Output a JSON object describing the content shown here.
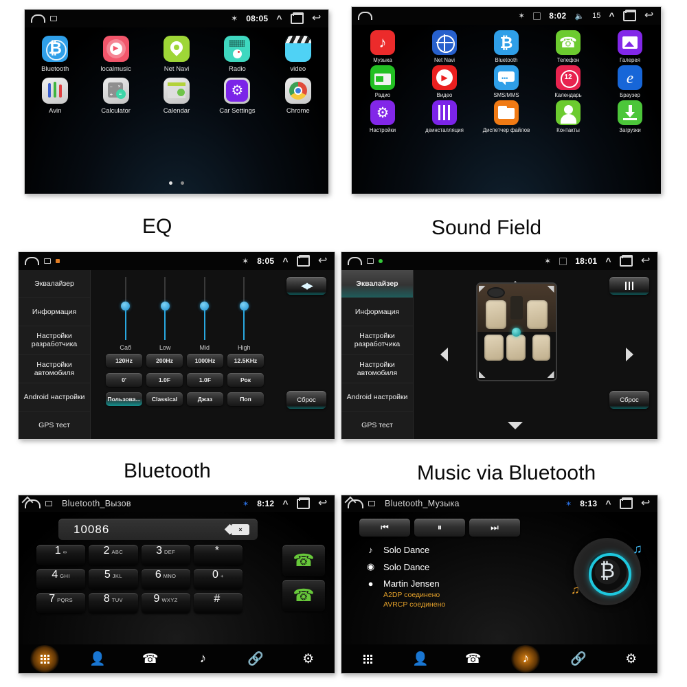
{
  "captions": {
    "eq": "EQ",
    "sound_field": "Sound Field",
    "bluetooth": "Bluetooth",
    "music_via_bluetooth": "Music via Bluetooth"
  },
  "panel1": {
    "status": {
      "time": "08:05",
      "bluetooth_icon": "bluetooth-icon",
      "chevron_icon": "chevron-up-icon",
      "recents_icon": "recents-icon",
      "back_icon": "back-icon",
      "home_icon": "home-icon"
    },
    "apps": [
      {
        "label": "Bluetooth",
        "icon": "bluetooth-icon",
        "bg": "#2f9fe8",
        "glyph": "฿"
      },
      {
        "label": "localmusic",
        "icon": "music-player-icon",
        "bg": "#f2566b",
        "glyph": "▶"
      },
      {
        "label": "Net Navi",
        "icon": "map-pin-icon",
        "bg": "#9ed637",
        "glyph": "⬤"
      },
      {
        "label": "Radio",
        "icon": "radio-icon",
        "bg": "#3fd8c0",
        "glyph": "◉"
      },
      {
        "label": "video",
        "icon": "clapperboard-icon",
        "bg": "#4fd2f5",
        "glyph": ""
      },
      {
        "label": "Avin",
        "icon": "avin-sliders-icon",
        "bg": "#d8d8d8",
        "glyph": "‖"
      },
      {
        "label": "Calculator",
        "icon": "calculator-icon",
        "bg": "#cfcfcf",
        "glyph": "="
      },
      {
        "label": "Calendar",
        "icon": "calendar-icon",
        "bg": "#cfcfcf",
        "glyph": ""
      },
      {
        "label": "Car Settings",
        "icon": "gear-icon",
        "bg": "#7b24e8",
        "glyph": "⚙"
      },
      {
        "label": "Chrome",
        "icon": "chrome-icon",
        "bg": "#e6e6e6",
        "glyph": "●"
      }
    ],
    "pager": {
      "active_index": 0,
      "count": 2
    }
  },
  "panel2": {
    "status": {
      "time": "8:02",
      "volume": "15",
      "bluetooth_icon": "bluetooth-icon",
      "signal_off_icon": "signal-off-icon",
      "volume_icon": "volume-icon",
      "chevron_icon": "chevron-up-icon",
      "recents_icon": "recents-icon",
      "back_icon": "back-icon",
      "home_icon": "home-icon"
    },
    "apps": [
      {
        "label": "Музыка",
        "icon": "music-note-icon",
        "bg": "#ec2b2b",
        "glyph": "♪"
      },
      {
        "label": "Net Navi",
        "icon": "compass-icon",
        "bg": "#2760cc",
        "glyph": "✲"
      },
      {
        "label": "Bluetooth",
        "icon": "bluetooth-icon",
        "bg": "#2f9fe8",
        "glyph": "฿"
      },
      {
        "label": "Телефон",
        "icon": "phone-icon",
        "bg": "#6ccb2f",
        "glyph": "✆"
      },
      {
        "label": "Галерея",
        "icon": "gallery-icon",
        "bg": "#8227e8",
        "glyph": "ὛB"
      },
      {
        "label": "Радио",
        "icon": "radio-icon",
        "bg": "#23c023",
        "glyph": "▤"
      },
      {
        "label": "Видео",
        "icon": "video-play-icon",
        "bg": "#ea1f1f",
        "glyph": "▶"
      },
      {
        "label": "SMS/MMS",
        "icon": "message-icon",
        "bg": "#2f9fe8",
        "glyph": "…"
      },
      {
        "label": "Календарь",
        "icon": "calendar-icon",
        "bg": "#e8234f",
        "glyph": "12"
      },
      {
        "label": "Браузер",
        "icon": "explorer-icon",
        "bg": "#1766d8",
        "glyph": "e"
      },
      {
        "label": "Настройки",
        "icon": "gear-icon",
        "bg": "#8227e8",
        "glyph": "⚙"
      },
      {
        "label": "деинсталляция",
        "icon": "uninstall-icon",
        "bg": "#7b24e8",
        "glyph": "‖"
      },
      {
        "label": "Диспетчер файлов",
        "icon": "folder-icon",
        "bg": "#f07a14",
        "glyph": "▱"
      },
      {
        "label": "Контакты",
        "icon": "contacts-icon",
        "bg": "#6ccb2f",
        "glyph": "●"
      },
      {
        "label": "Загрузки",
        "icon": "download-icon",
        "bg": "#4cc63a",
        "glyph": "↓"
      }
    ]
  },
  "panel3": {
    "status": {
      "time": "8:05",
      "bluetooth_icon": "bluetooth-icon",
      "home_icon": "home-icon",
      "chevron_icon": "chevron-up-icon",
      "recents_icon": "recents-icon",
      "back_icon": "back-icon"
    },
    "sidebar": [
      {
        "label": "Эквалайзер",
        "selected": false
      },
      {
        "label": "Информация",
        "selected": false
      },
      {
        "label": "Настройки разработчика",
        "selected": false
      },
      {
        "label": "Настройки автомобиля",
        "selected": false
      },
      {
        "label": "Android настройки",
        "selected": false
      },
      {
        "label": "GPS тест",
        "selected": false
      }
    ],
    "sliders": [
      {
        "label": "Саб",
        "value": 50
      },
      {
        "label": "Low",
        "value": 50
      },
      {
        "label": "Mid",
        "value": 50
      },
      {
        "label": "High",
        "value": 50
      }
    ],
    "freq_row": [
      "120Hz",
      "200Hz",
      "1000Hz",
      "12.5KHz"
    ],
    "value_row": [
      "0'",
      "1.0F",
      "1.0F",
      "Рок"
    ],
    "preset_row": [
      "Пользова...",
      "Classical",
      "Джаз",
      "Поп"
    ],
    "preset_active_index": 0,
    "top_button": {
      "label": "",
      "icon": "sound-field-icon"
    },
    "reset_button": {
      "label": "Сброс",
      "icon": "reset-button"
    }
  },
  "panel4": {
    "status": {
      "time": "18:01",
      "bluetooth_icon": "bluetooth-icon",
      "signal_off_icon": "signal-off-icon",
      "home_icon": "home-icon",
      "chevron_icon": "chevron-up-icon",
      "recents_icon": "recents-icon",
      "back_icon": "back-icon"
    },
    "sidebar": [
      {
        "label": "Эквалайзер",
        "selected": true
      },
      {
        "label": "Информация",
        "selected": false
      },
      {
        "label": "Настройки разработчика",
        "selected": false
      },
      {
        "label": "Настройки автомобиля",
        "selected": false
      },
      {
        "label": "Android настройки",
        "selected": false
      },
      {
        "label": "GPS тест",
        "selected": false
      }
    ],
    "arrows": {
      "up": "arrow-up-icon",
      "down": "arrow-down-icon",
      "left": "arrow-left-icon",
      "right": "arrow-right-icon"
    },
    "top_button": {
      "label": "",
      "icon": "equalizer-icon"
    },
    "reset_button": {
      "label": "Сброс",
      "icon": "reset-button"
    }
  },
  "panel5": {
    "status": {
      "title": "Bluetooth_Вызов",
      "time": "8:12",
      "bluetooth_icon": "bluetooth-icon",
      "home_icon": "home-icon",
      "chevron_icon": "chevron-up-icon",
      "recents_icon": "recents-icon",
      "back_icon": "back-icon"
    },
    "number_value": "10086",
    "number_placeholder": "",
    "backspace_icon": "backspace-icon",
    "keys": [
      {
        "num": "1",
        "sub": "∞"
      },
      {
        "num": "2",
        "sub": "ABC"
      },
      {
        "num": "3",
        "sub": "DEF"
      },
      {
        "num": "*",
        "sub": ""
      },
      {
        "num": "4",
        "sub": "GHI"
      },
      {
        "num": "5",
        "sub": "JKL"
      },
      {
        "num": "6",
        "sub": "MNO"
      },
      {
        "num": "0",
        "sub": "+"
      },
      {
        "num": "7",
        "sub": "PQRS"
      },
      {
        "num": "8",
        "sub": "TUV"
      },
      {
        "num": "9",
        "sub": "WXYZ"
      },
      {
        "num": "#",
        "sub": ""
      }
    ],
    "call_button": "call-button",
    "hangup_button": "call-history-button",
    "nav": [
      {
        "icon": "keypad-icon",
        "active": true
      },
      {
        "icon": "contacts-icon",
        "active": false
      },
      {
        "icon": "call-log-icon",
        "active": false
      },
      {
        "icon": "music-icon",
        "active": false
      },
      {
        "icon": "link-icon",
        "active": false
      },
      {
        "icon": "settings-icon",
        "active": false
      }
    ]
  },
  "panel6": {
    "status": {
      "title": "Bluetooth_Музыка",
      "time": "8:13",
      "bluetooth_icon": "bluetooth-icon",
      "home_icon": "home-icon",
      "chevron_icon": "chevron-up-icon",
      "recents_icon": "recents-icon",
      "back_icon": "back-icon"
    },
    "controls": [
      {
        "icon": "previous-track-icon",
        "glyph": "⏮"
      },
      {
        "icon": "pause-icon",
        "glyph": "⏸"
      },
      {
        "icon": "next-track-icon",
        "glyph": "⏭"
      }
    ],
    "track": {
      "icon": "track-icon",
      "glyph": "♪",
      "text": "Solo Dance"
    },
    "album": {
      "icon": "album-icon",
      "glyph": "◉",
      "text": "Solo Dance"
    },
    "artist": {
      "icon": "artist-icon",
      "glyph": "●",
      "text": "Martin Jensen"
    },
    "status_lines": [
      "A2DP соединено",
      "AVRCP соединено"
    ],
    "disc_icon": "bluetooth-disc-icon",
    "nav": [
      {
        "icon": "keypad-icon",
        "active": false
      },
      {
        "icon": "contacts-icon",
        "active": false
      },
      {
        "icon": "call-log-icon",
        "active": false
      },
      {
        "icon": "music-icon",
        "active": true
      },
      {
        "icon": "link-icon",
        "active": false
      },
      {
        "icon": "settings-icon",
        "active": false
      }
    ]
  }
}
